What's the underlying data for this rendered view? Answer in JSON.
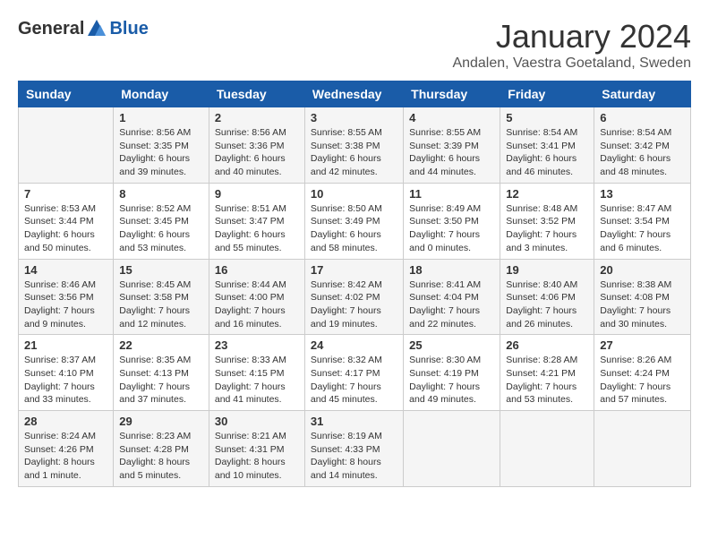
{
  "header": {
    "logo_general": "General",
    "logo_blue": "Blue",
    "title": "January 2024",
    "location": "Andalen, Vaestra Goetaland, Sweden"
  },
  "days_of_week": [
    "Sunday",
    "Monday",
    "Tuesday",
    "Wednesday",
    "Thursday",
    "Friday",
    "Saturday"
  ],
  "weeks": [
    [
      {
        "day": "",
        "sunrise": "",
        "sunset": "",
        "daylight": ""
      },
      {
        "day": "1",
        "sunrise": "Sunrise: 8:56 AM",
        "sunset": "Sunset: 3:35 PM",
        "daylight": "Daylight: 6 hours and 39 minutes."
      },
      {
        "day": "2",
        "sunrise": "Sunrise: 8:56 AM",
        "sunset": "Sunset: 3:36 PM",
        "daylight": "Daylight: 6 hours and 40 minutes."
      },
      {
        "day": "3",
        "sunrise": "Sunrise: 8:55 AM",
        "sunset": "Sunset: 3:38 PM",
        "daylight": "Daylight: 6 hours and 42 minutes."
      },
      {
        "day": "4",
        "sunrise": "Sunrise: 8:55 AM",
        "sunset": "Sunset: 3:39 PM",
        "daylight": "Daylight: 6 hours and 44 minutes."
      },
      {
        "day": "5",
        "sunrise": "Sunrise: 8:54 AM",
        "sunset": "Sunset: 3:41 PM",
        "daylight": "Daylight: 6 hours and 46 minutes."
      },
      {
        "day": "6",
        "sunrise": "Sunrise: 8:54 AM",
        "sunset": "Sunset: 3:42 PM",
        "daylight": "Daylight: 6 hours and 48 minutes."
      }
    ],
    [
      {
        "day": "7",
        "sunrise": "Sunrise: 8:53 AM",
        "sunset": "Sunset: 3:44 PM",
        "daylight": "Daylight: 6 hours and 50 minutes."
      },
      {
        "day": "8",
        "sunrise": "Sunrise: 8:52 AM",
        "sunset": "Sunset: 3:45 PM",
        "daylight": "Daylight: 6 hours and 53 minutes."
      },
      {
        "day": "9",
        "sunrise": "Sunrise: 8:51 AM",
        "sunset": "Sunset: 3:47 PM",
        "daylight": "Daylight: 6 hours and 55 minutes."
      },
      {
        "day": "10",
        "sunrise": "Sunrise: 8:50 AM",
        "sunset": "Sunset: 3:49 PM",
        "daylight": "Daylight: 6 hours and 58 minutes."
      },
      {
        "day": "11",
        "sunrise": "Sunrise: 8:49 AM",
        "sunset": "Sunset: 3:50 PM",
        "daylight": "Daylight: 7 hours and 0 minutes."
      },
      {
        "day": "12",
        "sunrise": "Sunrise: 8:48 AM",
        "sunset": "Sunset: 3:52 PM",
        "daylight": "Daylight: 7 hours and 3 minutes."
      },
      {
        "day": "13",
        "sunrise": "Sunrise: 8:47 AM",
        "sunset": "Sunset: 3:54 PM",
        "daylight": "Daylight: 7 hours and 6 minutes."
      }
    ],
    [
      {
        "day": "14",
        "sunrise": "Sunrise: 8:46 AM",
        "sunset": "Sunset: 3:56 PM",
        "daylight": "Daylight: 7 hours and 9 minutes."
      },
      {
        "day": "15",
        "sunrise": "Sunrise: 8:45 AM",
        "sunset": "Sunset: 3:58 PM",
        "daylight": "Daylight: 7 hours and 12 minutes."
      },
      {
        "day": "16",
        "sunrise": "Sunrise: 8:44 AM",
        "sunset": "Sunset: 4:00 PM",
        "daylight": "Daylight: 7 hours and 16 minutes."
      },
      {
        "day": "17",
        "sunrise": "Sunrise: 8:42 AM",
        "sunset": "Sunset: 4:02 PM",
        "daylight": "Daylight: 7 hours and 19 minutes."
      },
      {
        "day": "18",
        "sunrise": "Sunrise: 8:41 AM",
        "sunset": "Sunset: 4:04 PM",
        "daylight": "Daylight: 7 hours and 22 minutes."
      },
      {
        "day": "19",
        "sunrise": "Sunrise: 8:40 AM",
        "sunset": "Sunset: 4:06 PM",
        "daylight": "Daylight: 7 hours and 26 minutes."
      },
      {
        "day": "20",
        "sunrise": "Sunrise: 8:38 AM",
        "sunset": "Sunset: 4:08 PM",
        "daylight": "Daylight: 7 hours and 30 minutes."
      }
    ],
    [
      {
        "day": "21",
        "sunrise": "Sunrise: 8:37 AM",
        "sunset": "Sunset: 4:10 PM",
        "daylight": "Daylight: 7 hours and 33 minutes."
      },
      {
        "day": "22",
        "sunrise": "Sunrise: 8:35 AM",
        "sunset": "Sunset: 4:13 PM",
        "daylight": "Daylight: 7 hours and 37 minutes."
      },
      {
        "day": "23",
        "sunrise": "Sunrise: 8:33 AM",
        "sunset": "Sunset: 4:15 PM",
        "daylight": "Daylight: 7 hours and 41 minutes."
      },
      {
        "day": "24",
        "sunrise": "Sunrise: 8:32 AM",
        "sunset": "Sunset: 4:17 PM",
        "daylight": "Daylight: 7 hours and 45 minutes."
      },
      {
        "day": "25",
        "sunrise": "Sunrise: 8:30 AM",
        "sunset": "Sunset: 4:19 PM",
        "daylight": "Daylight: 7 hours and 49 minutes."
      },
      {
        "day": "26",
        "sunrise": "Sunrise: 8:28 AM",
        "sunset": "Sunset: 4:21 PM",
        "daylight": "Daylight: 7 hours and 53 minutes."
      },
      {
        "day": "27",
        "sunrise": "Sunrise: 8:26 AM",
        "sunset": "Sunset: 4:24 PM",
        "daylight": "Daylight: 7 hours and 57 minutes."
      }
    ],
    [
      {
        "day": "28",
        "sunrise": "Sunrise: 8:24 AM",
        "sunset": "Sunset: 4:26 PM",
        "daylight": "Daylight: 8 hours and 1 minute."
      },
      {
        "day": "29",
        "sunrise": "Sunrise: 8:23 AM",
        "sunset": "Sunset: 4:28 PM",
        "daylight": "Daylight: 8 hours and 5 minutes."
      },
      {
        "day": "30",
        "sunrise": "Sunrise: 8:21 AM",
        "sunset": "Sunset: 4:31 PM",
        "daylight": "Daylight: 8 hours and 10 minutes."
      },
      {
        "day": "31",
        "sunrise": "Sunrise: 8:19 AM",
        "sunset": "Sunset: 4:33 PM",
        "daylight": "Daylight: 8 hours and 14 minutes."
      },
      {
        "day": "",
        "sunrise": "",
        "sunset": "",
        "daylight": ""
      },
      {
        "day": "",
        "sunrise": "",
        "sunset": "",
        "daylight": ""
      },
      {
        "day": "",
        "sunrise": "",
        "sunset": "",
        "daylight": ""
      }
    ]
  ]
}
